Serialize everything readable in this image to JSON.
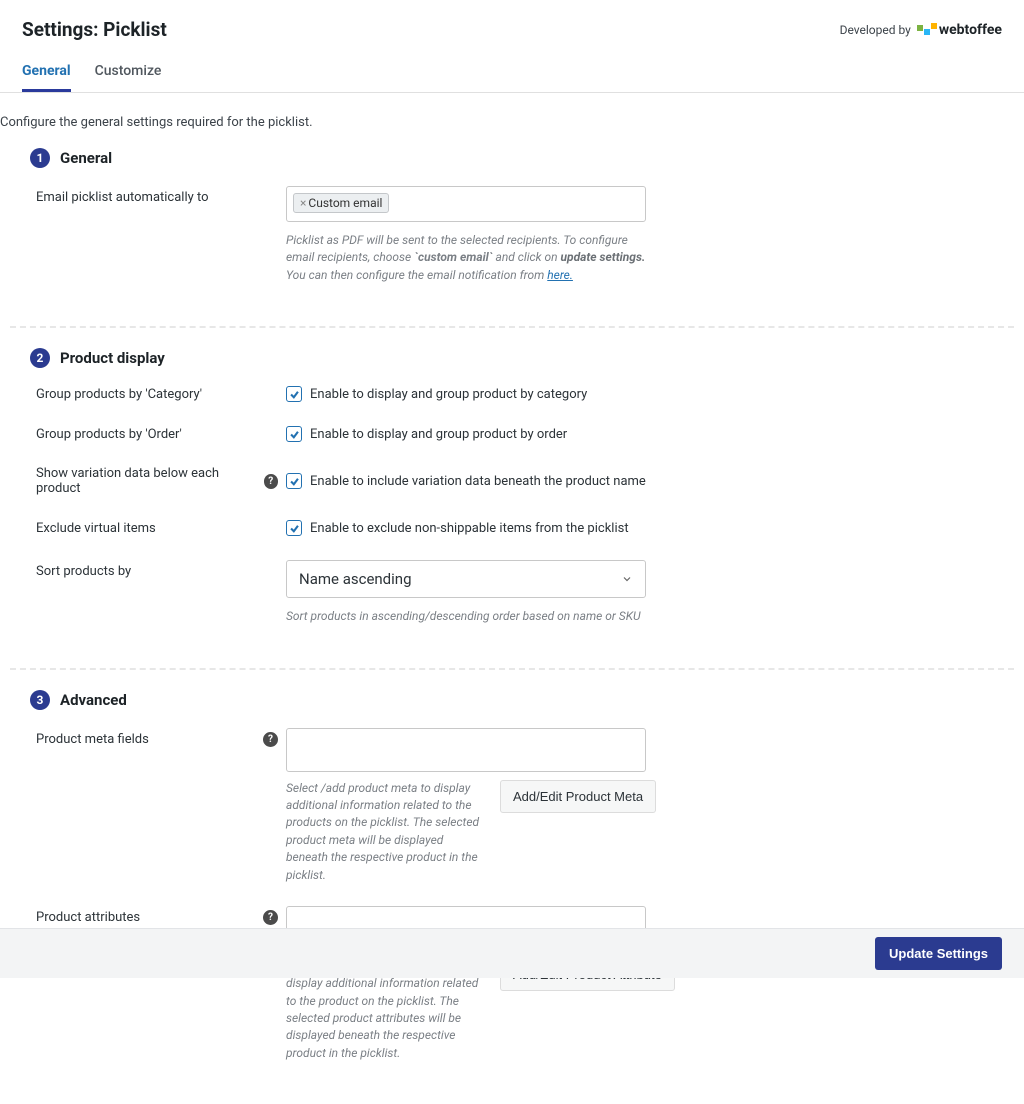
{
  "header": {
    "title": "Settings: Picklist",
    "developed_by": "Developed by",
    "brand": "webtoffee"
  },
  "tabs": {
    "general": "General",
    "customize": "Customize"
  },
  "intro": "Configure the general settings required for the picklist.",
  "section1": {
    "num": "1",
    "title": "General",
    "email_label": "Email picklist automatically to",
    "chip_x": "×",
    "chip_text": "Custom email",
    "help_pre": "Picklist as PDF will be sent to the selected recipients. To configure email recipients, choose ",
    "help_code": "`custom email`",
    "help_mid": " and click on ",
    "help_bold": "update settings.",
    "help_post": " You can then configure the email notification from ",
    "help_link": "here."
  },
  "section2": {
    "num": "2",
    "title": "Product display",
    "row1_label": "Group products by 'Category'",
    "row1_cb": "Enable to display and group product by category",
    "row2_label": "Group products by 'Order'",
    "row2_cb": "Enable to display and group product by order",
    "row3_label": "Show variation data below each product",
    "row3_cb": "Enable to include variation data beneath the product name",
    "row4_label": "Exclude virtual items",
    "row4_cb": "Enable to exclude non-shippable items from the picklist",
    "sort_label": "Sort products by",
    "sort_value": "Name ascending",
    "sort_help": "Sort products in ascending/descending order based on name or SKU"
  },
  "section3": {
    "num": "3",
    "title": "Advanced",
    "meta_label": "Product meta fields",
    "meta_help": "Select /add product meta to display additional information related to the products on the picklist. The selected product meta will be displayed beneath the respective product in the picklist.",
    "meta_button": "Add/Edit Product Meta",
    "attr_label": "Product attributes",
    "attr_help": "Select/add product attributes to display additional information related to the product on the picklist. The selected product attributes will be displayed beneath the respective product in the picklist.",
    "attr_button": "Add/Edit Product Attribute"
  },
  "footer": {
    "update": "Update Settings"
  },
  "help_q": "?"
}
